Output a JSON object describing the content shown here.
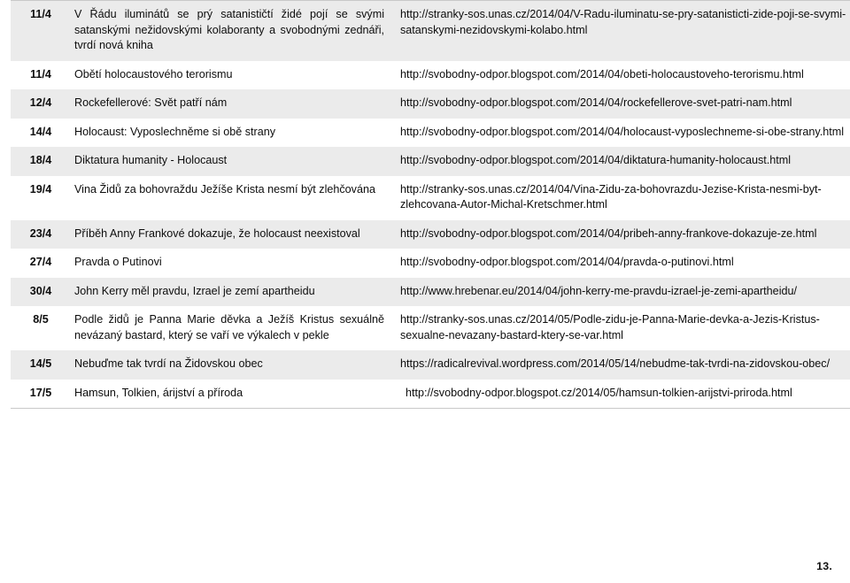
{
  "document": {
    "page_number": "13.",
    "columns": [
      "date",
      "title",
      "url"
    ],
    "rows": [
      {
        "date": "11/4",
        "title": "V Řádu iluminátů se prý satanističtí židé pojí se svými satanskými nežidovskými kolaboranty a svobodnými zednáři, tvrdí nová kniha",
        "url": "http://stranky-sos.unas.cz/2014/04/V-Radu-iluminatu-se-pry-satanisticti-zide-poji-se-svymi-satanskymi-nezidovskymi-kolabo.html",
        "shaded": true,
        "justified": true
      },
      {
        "date": "11/4",
        "title": "Obětí holocaustového terorismu",
        "url": "http://svobodny-odpor.blogspot.com/2014/04/obeti-holocaustoveho-terorismu.html",
        "shaded": false,
        "justified": false
      },
      {
        "date": "12/4",
        "title": "Rockefellerové: Svět patří nám",
        "url": "http://svobodny-odpor.blogspot.com/2014/04/rockefellerove-svet-patri-nam.html",
        "shaded": true,
        "justified": false
      },
      {
        "date": "14/4",
        "title": "Holocaust: Vyposlechněme si obě strany",
        "url": "http://svobodny-odpor.blogspot.com/2014/04/holocaust-vyposlechneme-si-obe-strany.html",
        "shaded": false,
        "justified": false
      },
      {
        "date": "18/4",
        "title": "Diktatura humanity - Holocaust",
        "url": "http://svobodny-odpor.blogspot.com/2014/04/diktatura-humanity-holocaust.html",
        "shaded": true,
        "justified": false
      },
      {
        "date": "19/4",
        "title": "Vina Židů za bohovraždu Ježíše Krista nesmí být zlehčována",
        "url": "http://stranky-sos.unas.cz/2014/04/Vina-Zidu-za-bohovrazdu-Jezise-Krista-nesmi-byt-zlehcovana-Autor-Michal-Kretschmer.html",
        "shaded": false,
        "justified": true
      },
      {
        "date": "23/4",
        "title": "Příběh Anny Frankové dokazuje, že holocaust neexistoval",
        "url": "http://svobodny-odpor.blogspot.com/2014/04/pribeh-anny-frankove-dokazuje-ze.html",
        "shaded": true,
        "justified": true
      },
      {
        "date": "27/4",
        "title": "Pravda o Putinovi",
        "url": "http://svobodny-odpor.blogspot.com/2014/04/pravda-o-putinovi.html",
        "shaded": false,
        "justified": false
      },
      {
        "date": "30/4",
        "title": "John Kerry měl pravdu, Izrael je zemí apartheidu",
        "url": "http://www.hrebenar.eu/2014/04/john-kerry-me-pravdu-izrael-je-zemi-apartheidu/",
        "shaded": true,
        "justified": false
      },
      {
        "date": "8/5",
        "title": "Podle židů je Panna Marie děvka a Ježíš Kristus sexuálně nevázaný bastard, který se vaří ve výkalech v pekle",
        "url": "http://stranky-sos.unas.cz/2014/05/Podle-zidu-je-Panna-Marie-devka-a-Jezis-Kristus-sexualne-nevazany-bastard-ktery-se-var.html",
        "shaded": false,
        "justified": true
      },
      {
        "date": "14/5",
        "title": "Nebuďme tak tvrdí na Židovskou obec",
        "url": "https://radicalrevival.wordpress.com/2014/05/14/nebudme-tak-tvrdi-na-zidovskou-obec/",
        "shaded": true,
        "justified": false
      },
      {
        "date": "17/5",
        "title": "Hamsun, Tolkien, árijství a příroda",
        "url": "http://svobodny-odpor.blogspot.cz/2014/05/hamsun-tolkien-arijstvi-priroda.html",
        "shaded": false,
        "justified": false,
        "url_indented": true
      }
    ]
  }
}
